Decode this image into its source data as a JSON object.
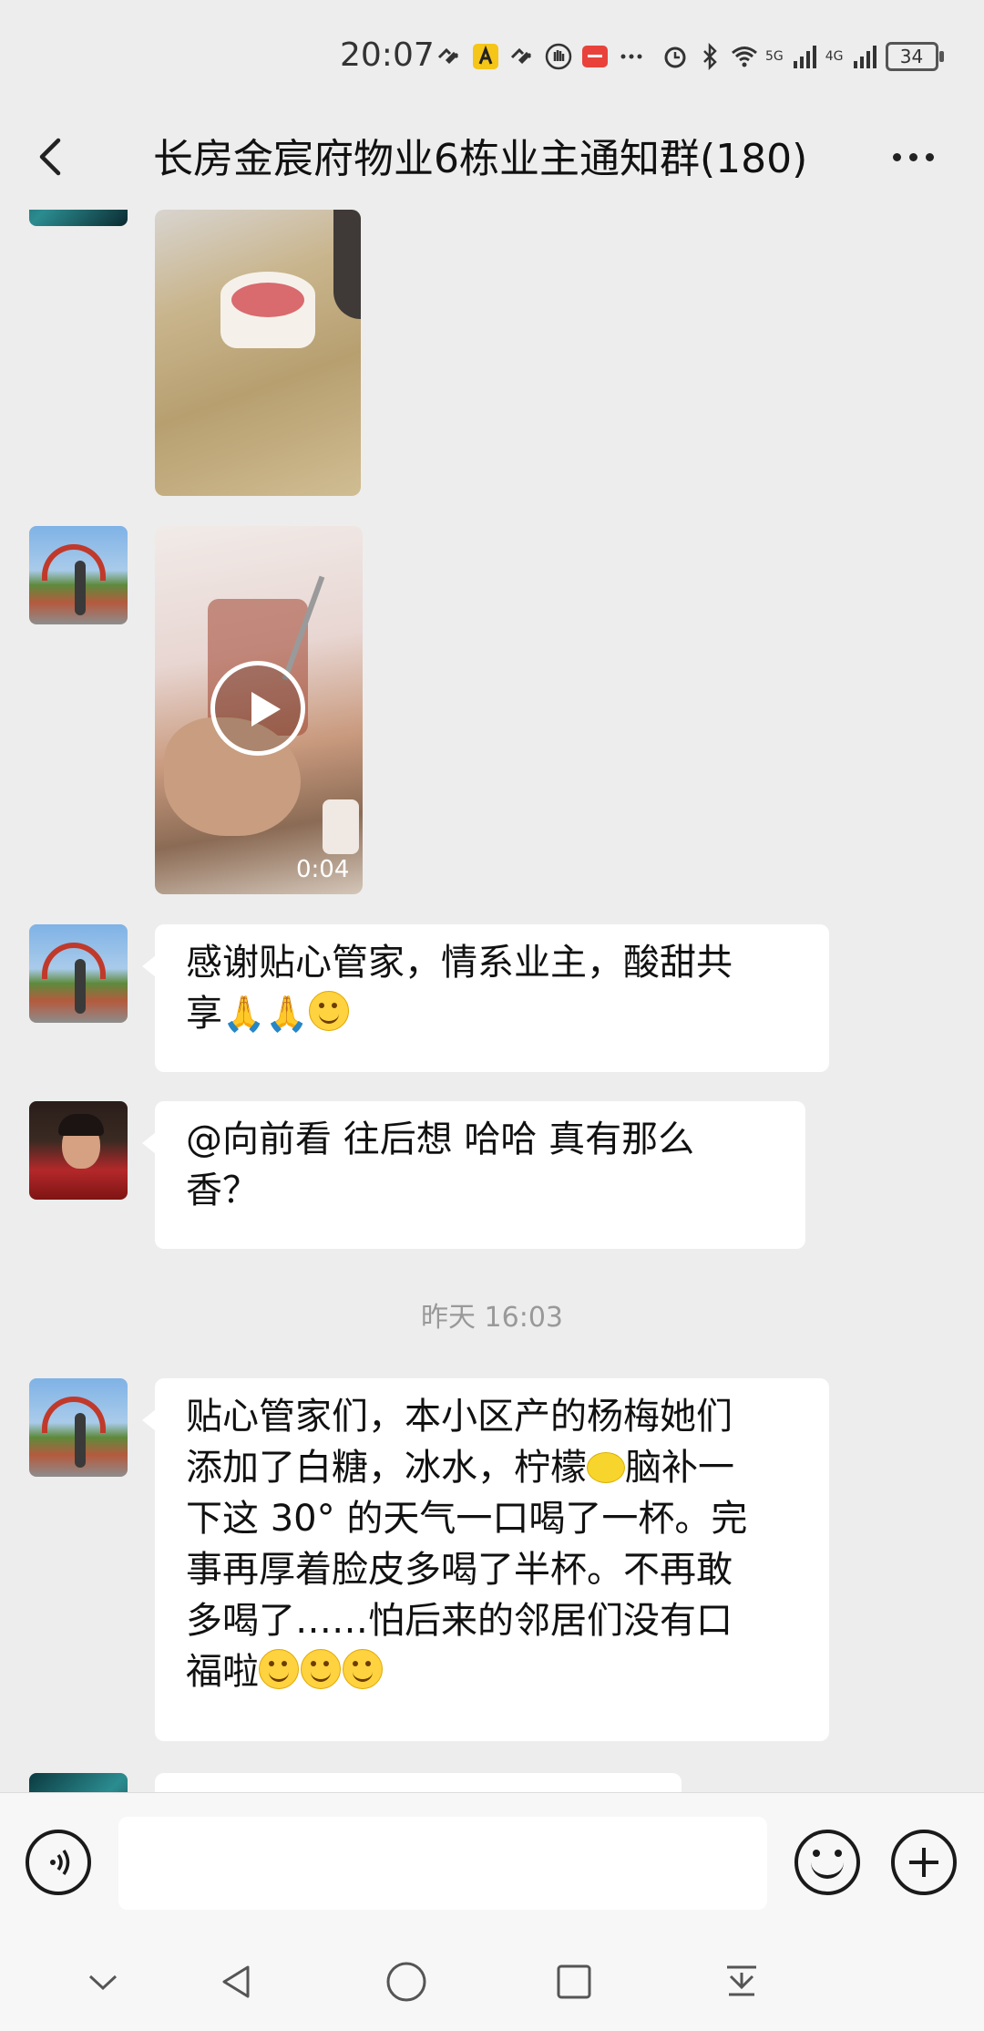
{
  "status_bar": {
    "time": "20:07",
    "icons": [
      "link-icon",
      "app-a-icon",
      "link-icon",
      "hand-icon",
      "red-app-icon",
      "more-dots-icon",
      "alarm-icon",
      "bluetooth-icon",
      "wifi-icon",
      "signal-5g-icon",
      "signal-4g-icon"
    ],
    "net_1": "5G",
    "net_2": "4G",
    "battery": "34"
  },
  "header": {
    "title": "长房金宸府物业6栋业主通知群(180)",
    "back_icon": "chevron-left-icon",
    "more_icon": "more-dots-icon"
  },
  "messages": [
    {
      "type": "image",
      "sender_avatar": "teal-avatar"
    },
    {
      "type": "video",
      "sender_avatar": "park-avatar",
      "duration": "0:04"
    },
    {
      "type": "text",
      "sender_avatar": "park-avatar",
      "lines": [
        "感谢贴心管家，情系业主，酸甜共",
        "享"
      ],
      "emojis": [
        "🙏",
        "🙏",
        "grinning-face"
      ]
    },
    {
      "type": "text",
      "sender_avatar": "man-avatar",
      "lines": [
        "@向前看 往后想   哈哈 真有那么",
        "香？"
      ]
    },
    {
      "type": "timestamp",
      "text": "昨天 16:03"
    },
    {
      "type": "text",
      "sender_avatar": "park-avatar",
      "lines": [
        "贴心管家们，本小区产的杨梅她们",
        "添加了白糖，冰水，柠檬",
        "脑补一",
        "下这 30° 的天气一口喝了一杯。完",
        "事再厚着脸皮多喝了半杯。不再敢",
        "多喝了……怕后来的邻居们没有口",
        "福啦"
      ],
      "emojis": [
        "lemon",
        "smiling-face",
        "smiling-face",
        "smiling-face"
      ]
    }
  ],
  "input_bar": {
    "voice_icon": "voice-icon",
    "placeholder": "",
    "emoji_icon": "emoji-icon",
    "plus_icon": "plus-icon"
  },
  "nav_bar": {
    "icons": [
      "chevron-down-icon",
      "back-triangle-icon",
      "home-circle-icon",
      "recents-square-icon",
      "download-icon"
    ]
  }
}
